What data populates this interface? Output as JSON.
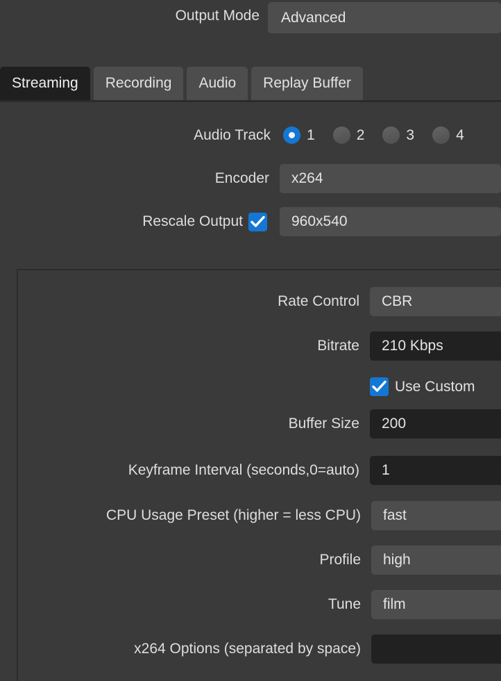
{
  "output_mode": {
    "label": "Output Mode",
    "value": "Advanced"
  },
  "tabs": [
    {
      "label": "Streaming",
      "selected": true
    },
    {
      "label": "Recording",
      "selected": false
    },
    {
      "label": "Audio",
      "selected": false
    },
    {
      "label": "Replay Buffer",
      "selected": false
    }
  ],
  "streaming": {
    "audio_track": {
      "label": "Audio Track",
      "options": [
        {
          "label": "1",
          "checked": true
        },
        {
          "label": "2",
          "checked": false
        },
        {
          "label": "3",
          "checked": false
        },
        {
          "label": "4",
          "checked": false
        }
      ]
    },
    "encoder": {
      "label": "Encoder",
      "value": "x264"
    },
    "rescale_output": {
      "label": "Rescale Output",
      "checked": true,
      "value": "960x540"
    }
  },
  "encoder_settings": {
    "rate_control": {
      "label": "Rate Control",
      "value": "CBR"
    },
    "bitrate": {
      "label": "Bitrate",
      "value": "210 Kbps"
    },
    "use_custom": {
      "label": "Use Custom",
      "checked": true
    },
    "buffer_size": {
      "label": "Buffer Size",
      "value": "200"
    },
    "keyframe_interval": {
      "label": "Keyframe Interval (seconds,0=auto)",
      "value": "1"
    },
    "cpu_usage_preset": {
      "label": "CPU Usage Preset (higher = less CPU)",
      "value": "fast"
    },
    "profile": {
      "label": "Profile",
      "value": "high"
    },
    "tune": {
      "label": "Tune",
      "value": "film"
    },
    "x264_options": {
      "label": "x264 Options (separated by space)",
      "value": "",
      "placeholder": ""
    }
  },
  "colors": {
    "background": "#3a3a3a",
    "accent": "#1477d4",
    "combo_bg": "#4d4d4d",
    "input_bg": "#212121",
    "tab_selected_bg": "#1f1f1f",
    "border": "#2b2b2b"
  }
}
